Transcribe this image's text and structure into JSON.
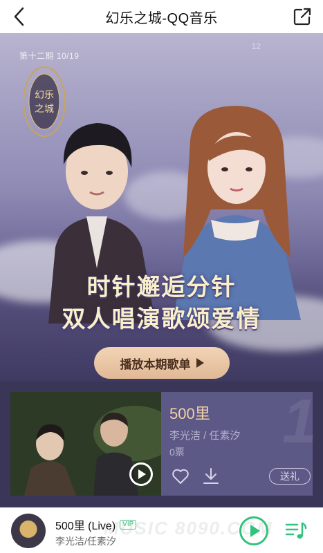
{
  "nav": {
    "title": "幻乐之城-QQ音乐",
    "back_icon": "chevron-left-icon",
    "share_icon": "share-external-icon"
  },
  "hero": {
    "issue": "第十二期  10/19",
    "count": "12",
    "headline_line1": "时针邂逅分针",
    "headline_line2": "双人唱演歌颂爱情",
    "play_button_label": "播放本期歌单",
    "logo_text": "幻乐之城"
  },
  "song_card": {
    "title": "500里",
    "artist": "李光洁 / 任素汐",
    "votes": "0票",
    "rank_number": "1",
    "gift_label": "送礼",
    "icons": [
      "play-circle-icon",
      "heart-icon",
      "download-icon"
    ]
  },
  "player": {
    "title": "500里 (Live)",
    "vip": "VIP",
    "artist": "李光洁/任素汐",
    "watermark": "MUSIC 8090.COM"
  },
  "colors": {
    "accent_green": "#31c27c",
    "gold_text": "#f1d1a8",
    "card_bg": "#5d5987",
    "page_bg": "#3a3657"
  }
}
